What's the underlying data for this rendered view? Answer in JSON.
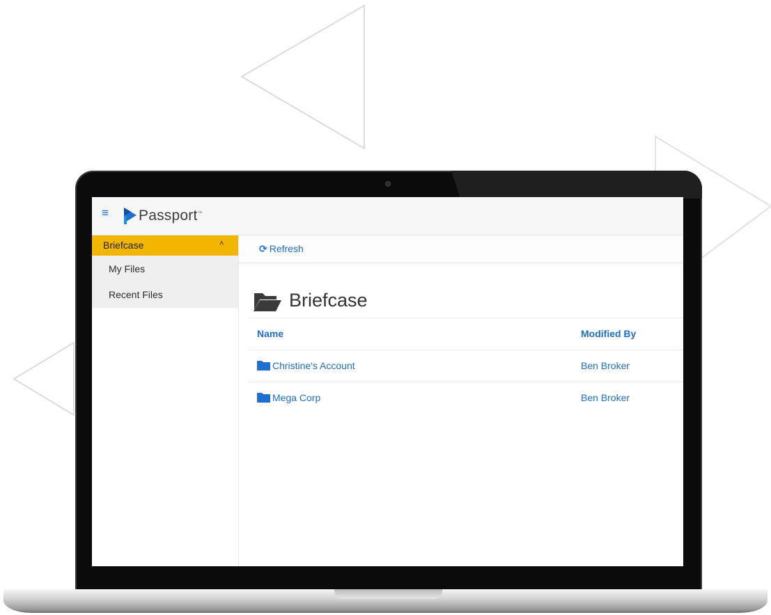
{
  "app": {
    "brand": "Passport",
    "brand_mark": "™",
    "accent_color": "#f2b500",
    "link_color": "#1e6fcf"
  },
  "topbar": {
    "menu_icon": "hamburger-icon",
    "menu_glyph": "≡"
  },
  "sidebar": {
    "section_label": "Briefcase",
    "section_chevron": "˄",
    "items": [
      {
        "label": "My Files"
      },
      {
        "label": "Recent Files"
      }
    ]
  },
  "toolbar": {
    "refresh_label": "Refresh",
    "refresh_glyph": "⟳"
  },
  "main": {
    "title": "Briefcase",
    "title_icon": "folder-open-icon"
  },
  "table": {
    "headers": {
      "name": "Name",
      "modified_by": "Modified By"
    },
    "rows": [
      {
        "name": "Christine's Account",
        "modified_by": "Ben Broker",
        "icon": "folder-icon"
      },
      {
        "name": "Mega Corp",
        "modified_by": "Ben Broker",
        "icon": "folder-icon"
      }
    ]
  }
}
